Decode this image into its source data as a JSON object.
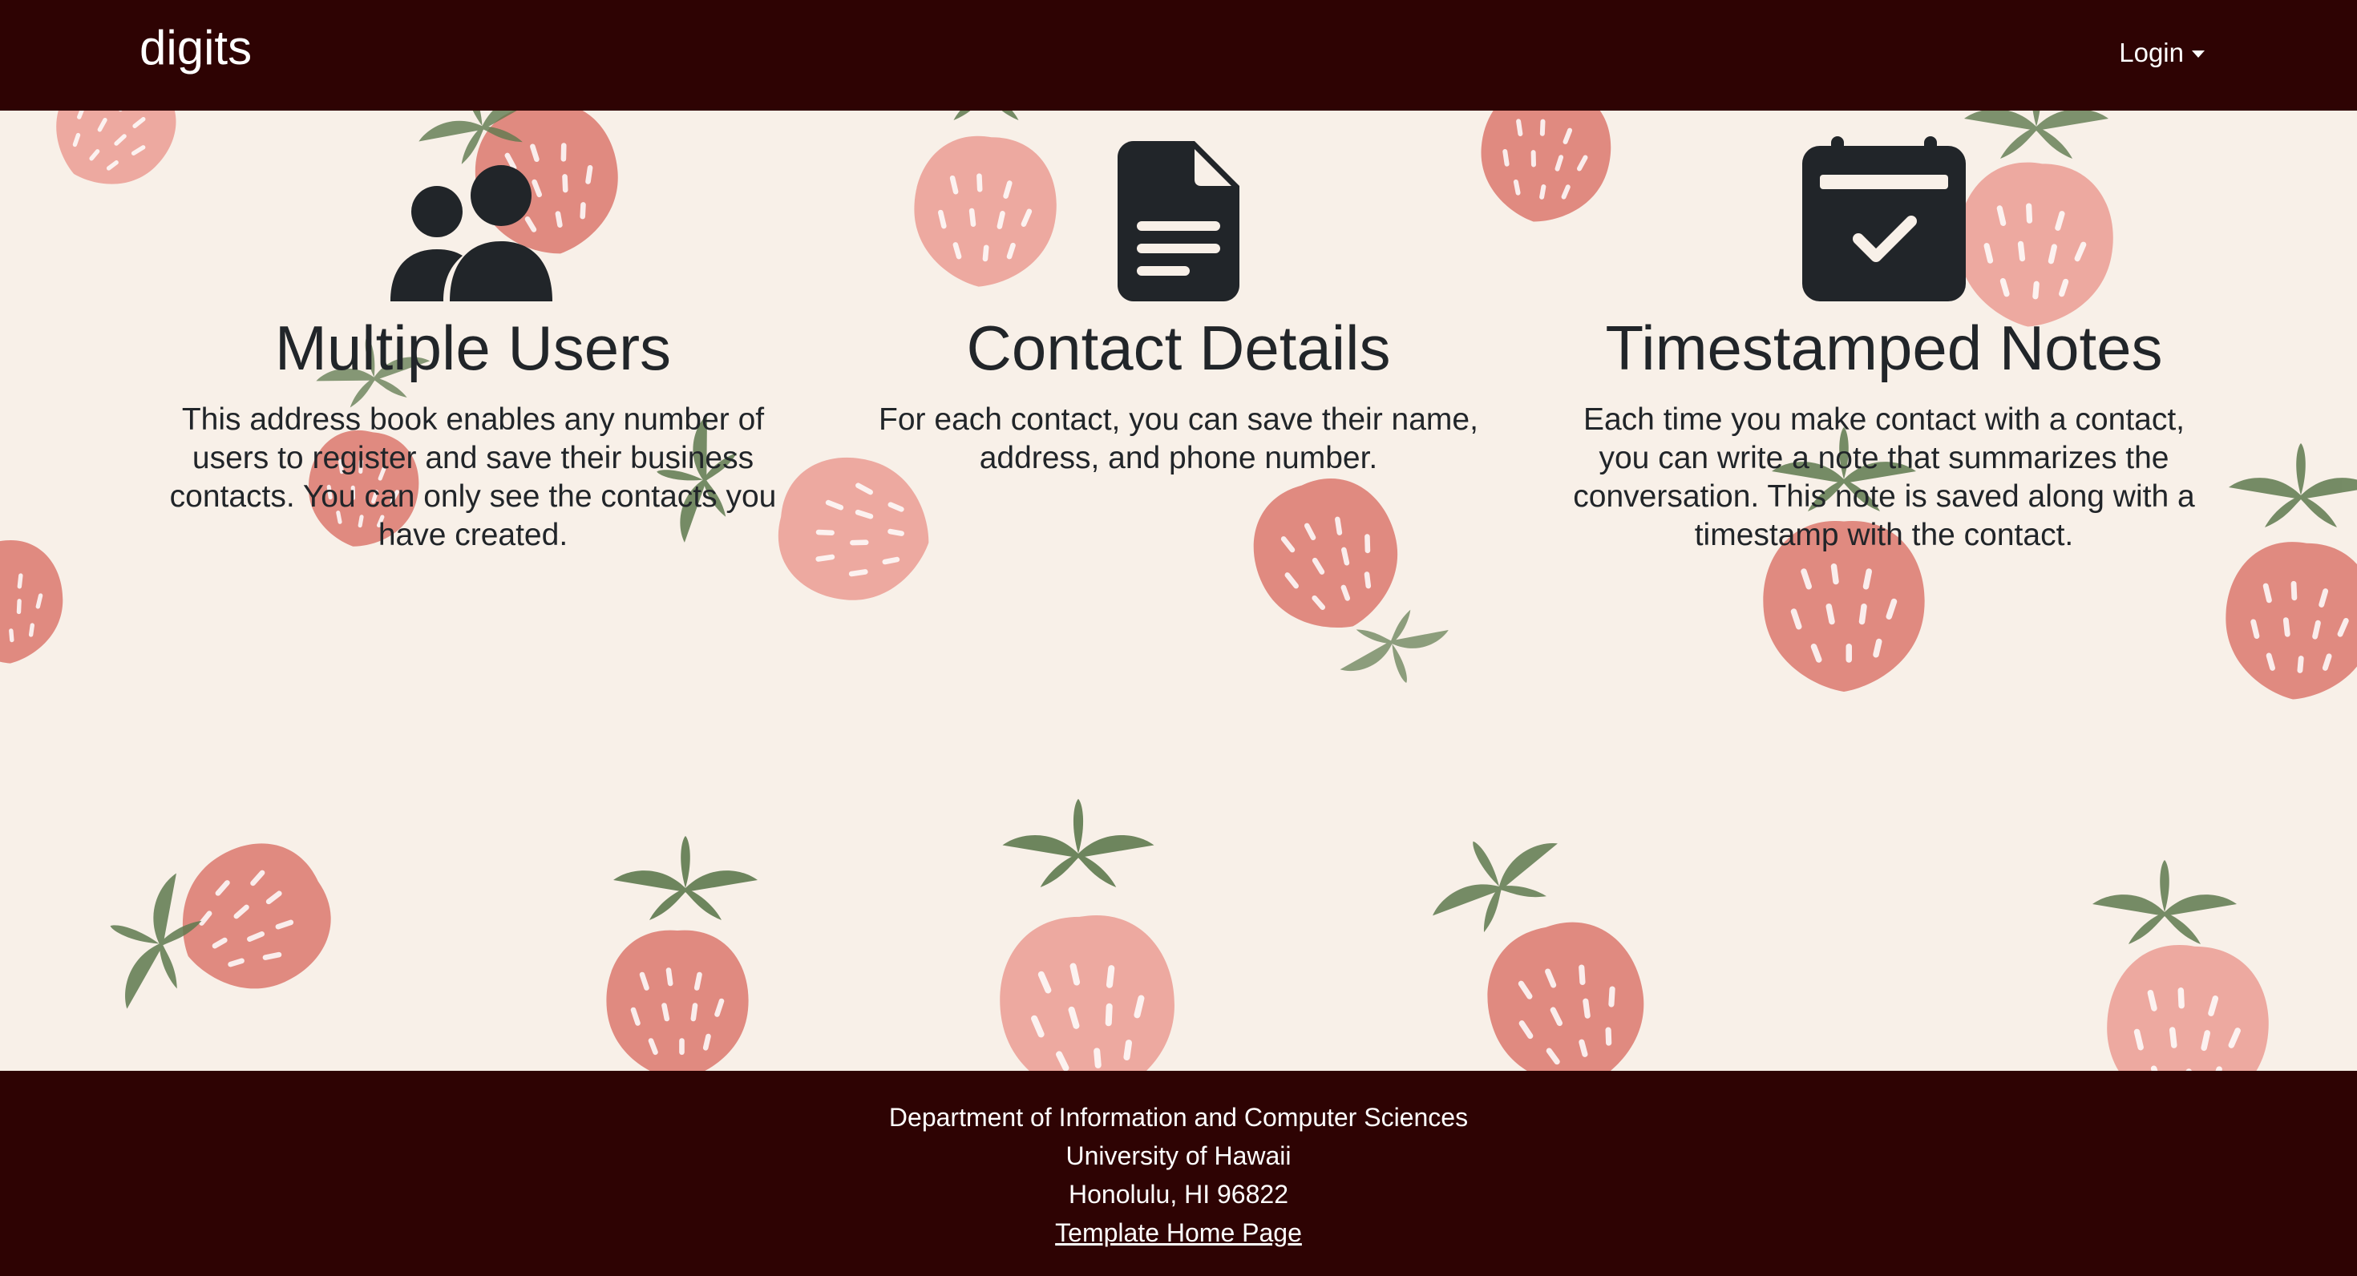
{
  "navbar": {
    "brand": "digits",
    "login_label": "Login"
  },
  "features": [
    {
      "icon": "people-fill-icon",
      "title": "Multiple Users",
      "text": "This address book enables any number of users to register and save their business contacts. You can only see the contacts you have created."
    },
    {
      "icon": "file-text-fill-icon",
      "title": "Contact Details",
      "text": "For each contact, you can save their name, address, and phone number."
    },
    {
      "icon": "calendar-check-fill-icon",
      "title": "Timestamped Notes",
      "text": "Each time you make contact with a contact, you can write a note that summarizes the conversation. This note is saved along with a timestamp with the contact."
    }
  ],
  "footer": {
    "line1": "Department of Information and Computer Sciences",
    "line2": "University of Hawaii",
    "line3": "Honolulu, HI 96822",
    "link": "Template Home Page"
  },
  "colors": {
    "nav_bg": "#2e0303",
    "page_bg": "#f8f0e8",
    "strawberry_red": "#e08a80",
    "strawberry_pink": "#eda9a0",
    "leaf_green": "#5f7a4f",
    "icon_dark": "#212529"
  }
}
